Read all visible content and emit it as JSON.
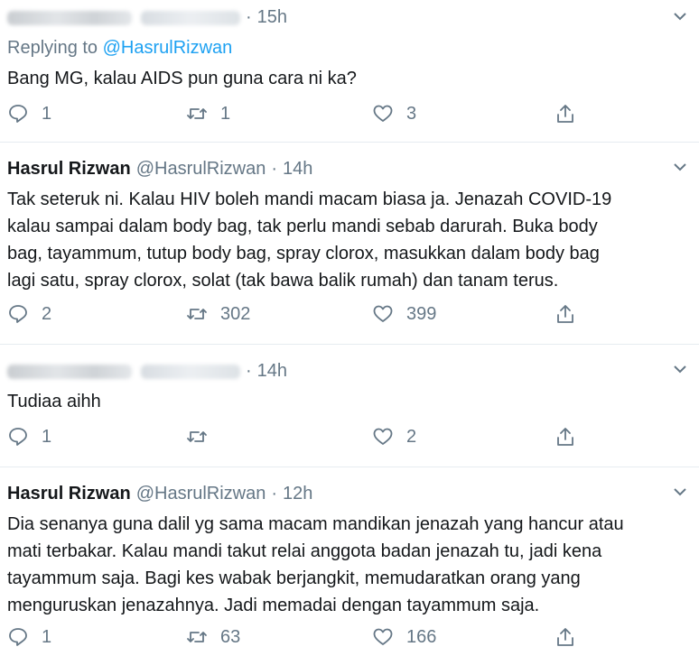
{
  "tweets": [
    {
      "name": "",
      "handle": "",
      "name_blurred": true,
      "time": "15h",
      "replying_label": "Replying to",
      "replying_to": "@HasrulRizwan",
      "text": "Bang MG, kalau AIDS pun guna cara ni ka?",
      "replies": "1",
      "retweets": "1",
      "likes": "3"
    },
    {
      "name": "Hasrul Rizwan",
      "handle": "@HasrulRizwan",
      "name_blurred": false,
      "time": "14h",
      "text_lines": [
        "Tak seteruk ni. Kalau HIV boleh mandi macam biasa ja. Jenazah COVID-19",
        "kalau sampai dalam body bag, tak perlu mandi sebab darurah. Buka body",
        "bag, tayammum, tutup body bag, spray clorox, masukkan dalam body bag",
        "lagi satu, spray clorox, solat (tak bawa balik rumah) dan tanam terus."
      ],
      "replies": "2",
      "retweets": "302",
      "likes": "399"
    },
    {
      "name": "",
      "handle": "",
      "name_blurred": true,
      "time": "14h",
      "text": "Tudiaa aihh",
      "replies": "1",
      "retweets": "",
      "likes": "2"
    },
    {
      "name": "Hasrul Rizwan",
      "handle": "@HasrulRizwan",
      "name_blurred": false,
      "time": "12h",
      "text_lines": [
        "Dia senanya guna dalil yg sama macam mandikan jenazah yang hancur atau",
        "mati terbakar. Kalau mandi takut relai anggota badan jenazah tu, jadi kena",
        "tayammum saja. Bagi kes wabak berjangkit, memudaratkan orang yang",
        "menguruskan jenazahnya. Jadi memadai dengan tayammum saja."
      ],
      "replies": "1",
      "retweets": "63",
      "likes": "166"
    }
  ],
  "separator": "·",
  "colors": {
    "text": "#14171a",
    "secondary": "#657786",
    "link": "#1da1f2",
    "divider": "#e6ecf0"
  },
  "icons": [
    "reply-icon",
    "retweet-icon",
    "like-icon",
    "share-icon",
    "chevron-down-icon"
  ]
}
